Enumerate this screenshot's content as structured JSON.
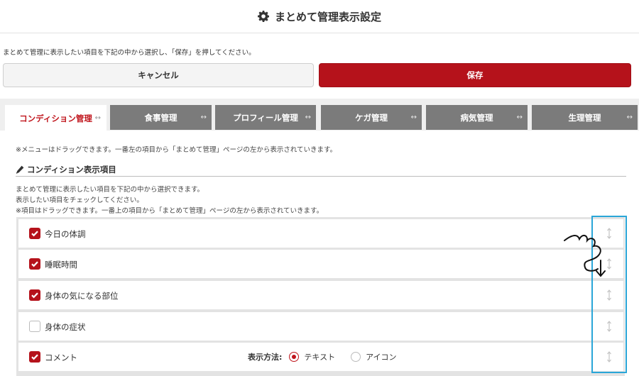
{
  "header": {
    "title": "まとめて管理表示設定",
    "icon": "gear-icon"
  },
  "instruction": "まとめて管理に表示したい項目を下記の中から選択し、「保存」を押してください。",
  "buttons": {
    "cancel": "キャンセル",
    "save": "保存"
  },
  "tabs": [
    {
      "label": "コンディション管理",
      "arrow": "↔",
      "active": true
    },
    {
      "label": "食事管理",
      "arrow": "↔",
      "active": false
    },
    {
      "label": "プロフィール管理",
      "arrow": "↔",
      "active": false
    },
    {
      "label": "ケガ管理",
      "arrow": "↔",
      "active": false
    },
    {
      "label": "病気管理",
      "arrow": "↔",
      "active": false
    },
    {
      "label": "生理管理",
      "arrow": "↔",
      "active": false
    }
  ],
  "tab_note": "※メニューはドラッグできます。一番左の項目から「まとめて管理」ページの左から表示されていきます。",
  "section": {
    "title": "コンディション表示項目",
    "icon": "pencil-icon",
    "desc1": "まとめて管理に表示したい項目を下記の中から選択できます。",
    "desc2": "表示したい項目をチェックしてください。",
    "desc3": "※項目はドラッグできます。一番上の項目から「まとめて管理」ページの左から表示されていきます。"
  },
  "items": [
    {
      "label": "今日の体調",
      "checked": true
    },
    {
      "label": "睡眠時間",
      "checked": true
    },
    {
      "label": "身体の気になる部位",
      "checked": true
    },
    {
      "label": "身体の症状",
      "checked": false
    },
    {
      "label": "コメント",
      "checked": true
    }
  ],
  "display_method": {
    "label": "表示方法:",
    "options": [
      {
        "label": "テキスト",
        "selected": true
      },
      {
        "label": "アイコン",
        "selected": false
      }
    ]
  },
  "colors": {
    "accent": "#b5121b",
    "tab_inactive": "#7b7b7b",
    "highlight": "#2aa6d8"
  }
}
